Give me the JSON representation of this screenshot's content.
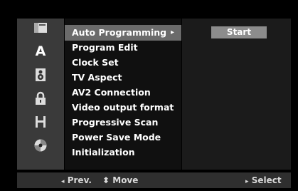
{
  "sidebar": {
    "icons": [
      "disc-icon",
      "language-a-icon",
      "speaker-icon",
      "lock-icon",
      "film-strip-icon",
      "others-disc-icon"
    ],
    "language_letter": "A"
  },
  "menu": {
    "items": [
      {
        "label": "Auto Programming",
        "selected": true,
        "has_submenu": true
      },
      {
        "label": "Program Edit"
      },
      {
        "label": "Clock Set"
      },
      {
        "label": "TV Aspect"
      },
      {
        "label": "AV2 Connection"
      },
      {
        "label": "Video output format"
      },
      {
        "label": "Progressive Scan"
      },
      {
        "label": "Power Save Mode"
      },
      {
        "label": "Initialization"
      }
    ],
    "submenu_arrow": "▸"
  },
  "right_pane": {
    "start_label": "Start"
  },
  "bottom_bar": {
    "prev_arrow": "◂",
    "prev_label": "Prev.",
    "move_arrows": "⬍",
    "move_label": "Move",
    "select_arrow": "▸",
    "select_label": "Select"
  },
  "colors": {
    "background": "#000000",
    "sidebar": "#3a3a3a",
    "menu": "#101010",
    "selected": "#6b6b6b",
    "button": "#8c8c8c",
    "bar": "#2f2f2f"
  }
}
